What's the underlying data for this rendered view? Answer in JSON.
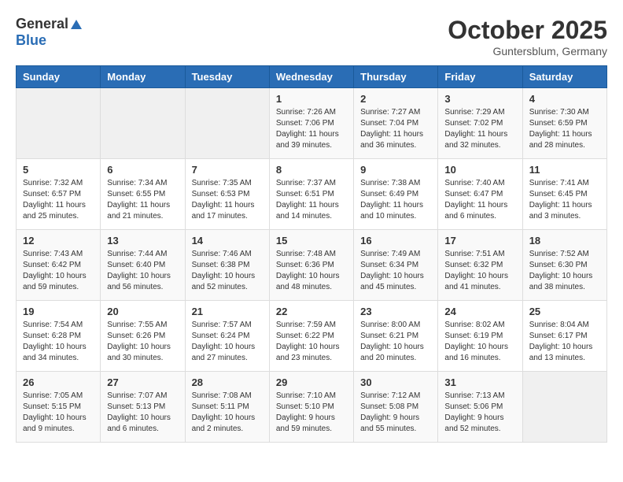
{
  "header": {
    "logo_general": "General",
    "logo_blue": "Blue",
    "month": "October 2025",
    "location": "Guntersblum, Germany"
  },
  "days_of_week": [
    "Sunday",
    "Monday",
    "Tuesday",
    "Wednesday",
    "Thursday",
    "Friday",
    "Saturday"
  ],
  "weeks": [
    [
      {
        "day": "",
        "sunrise": "",
        "sunset": "",
        "daylight": ""
      },
      {
        "day": "",
        "sunrise": "",
        "sunset": "",
        "daylight": ""
      },
      {
        "day": "",
        "sunrise": "",
        "sunset": "",
        "daylight": ""
      },
      {
        "day": "1",
        "sunrise": "Sunrise: 7:26 AM",
        "sunset": "Sunset: 7:06 PM",
        "daylight": "Daylight: 11 hours and 39 minutes."
      },
      {
        "day": "2",
        "sunrise": "Sunrise: 7:27 AM",
        "sunset": "Sunset: 7:04 PM",
        "daylight": "Daylight: 11 hours and 36 minutes."
      },
      {
        "day": "3",
        "sunrise": "Sunrise: 7:29 AM",
        "sunset": "Sunset: 7:02 PM",
        "daylight": "Daylight: 11 hours and 32 minutes."
      },
      {
        "day": "4",
        "sunrise": "Sunrise: 7:30 AM",
        "sunset": "Sunset: 6:59 PM",
        "daylight": "Daylight: 11 hours and 28 minutes."
      }
    ],
    [
      {
        "day": "5",
        "sunrise": "Sunrise: 7:32 AM",
        "sunset": "Sunset: 6:57 PM",
        "daylight": "Daylight: 11 hours and 25 minutes."
      },
      {
        "day": "6",
        "sunrise": "Sunrise: 7:34 AM",
        "sunset": "Sunset: 6:55 PM",
        "daylight": "Daylight: 11 hours and 21 minutes."
      },
      {
        "day": "7",
        "sunrise": "Sunrise: 7:35 AM",
        "sunset": "Sunset: 6:53 PM",
        "daylight": "Daylight: 11 hours and 17 minutes."
      },
      {
        "day": "8",
        "sunrise": "Sunrise: 7:37 AM",
        "sunset": "Sunset: 6:51 PM",
        "daylight": "Daylight: 11 hours and 14 minutes."
      },
      {
        "day": "9",
        "sunrise": "Sunrise: 7:38 AM",
        "sunset": "Sunset: 6:49 PM",
        "daylight": "Daylight: 11 hours and 10 minutes."
      },
      {
        "day": "10",
        "sunrise": "Sunrise: 7:40 AM",
        "sunset": "Sunset: 6:47 PM",
        "daylight": "Daylight: 11 hours and 6 minutes."
      },
      {
        "day": "11",
        "sunrise": "Sunrise: 7:41 AM",
        "sunset": "Sunset: 6:45 PM",
        "daylight": "Daylight: 11 hours and 3 minutes."
      }
    ],
    [
      {
        "day": "12",
        "sunrise": "Sunrise: 7:43 AM",
        "sunset": "Sunset: 6:42 PM",
        "daylight": "Daylight: 10 hours and 59 minutes."
      },
      {
        "day": "13",
        "sunrise": "Sunrise: 7:44 AM",
        "sunset": "Sunset: 6:40 PM",
        "daylight": "Daylight: 10 hours and 56 minutes."
      },
      {
        "day": "14",
        "sunrise": "Sunrise: 7:46 AM",
        "sunset": "Sunset: 6:38 PM",
        "daylight": "Daylight: 10 hours and 52 minutes."
      },
      {
        "day": "15",
        "sunrise": "Sunrise: 7:48 AM",
        "sunset": "Sunset: 6:36 PM",
        "daylight": "Daylight: 10 hours and 48 minutes."
      },
      {
        "day": "16",
        "sunrise": "Sunrise: 7:49 AM",
        "sunset": "Sunset: 6:34 PM",
        "daylight": "Daylight: 10 hours and 45 minutes."
      },
      {
        "day": "17",
        "sunrise": "Sunrise: 7:51 AM",
        "sunset": "Sunset: 6:32 PM",
        "daylight": "Daylight: 10 hours and 41 minutes."
      },
      {
        "day": "18",
        "sunrise": "Sunrise: 7:52 AM",
        "sunset": "Sunset: 6:30 PM",
        "daylight": "Daylight: 10 hours and 38 minutes."
      }
    ],
    [
      {
        "day": "19",
        "sunrise": "Sunrise: 7:54 AM",
        "sunset": "Sunset: 6:28 PM",
        "daylight": "Daylight: 10 hours and 34 minutes."
      },
      {
        "day": "20",
        "sunrise": "Sunrise: 7:55 AM",
        "sunset": "Sunset: 6:26 PM",
        "daylight": "Daylight: 10 hours and 30 minutes."
      },
      {
        "day": "21",
        "sunrise": "Sunrise: 7:57 AM",
        "sunset": "Sunset: 6:24 PM",
        "daylight": "Daylight: 10 hours and 27 minutes."
      },
      {
        "day": "22",
        "sunrise": "Sunrise: 7:59 AM",
        "sunset": "Sunset: 6:22 PM",
        "daylight": "Daylight: 10 hours and 23 minutes."
      },
      {
        "day": "23",
        "sunrise": "Sunrise: 8:00 AM",
        "sunset": "Sunset: 6:21 PM",
        "daylight": "Daylight: 10 hours and 20 minutes."
      },
      {
        "day": "24",
        "sunrise": "Sunrise: 8:02 AM",
        "sunset": "Sunset: 6:19 PM",
        "daylight": "Daylight: 10 hours and 16 minutes."
      },
      {
        "day": "25",
        "sunrise": "Sunrise: 8:04 AM",
        "sunset": "Sunset: 6:17 PM",
        "daylight": "Daylight: 10 hours and 13 minutes."
      }
    ],
    [
      {
        "day": "26",
        "sunrise": "Sunrise: 7:05 AM",
        "sunset": "Sunset: 5:15 PM",
        "daylight": "Daylight: 10 hours and 9 minutes."
      },
      {
        "day": "27",
        "sunrise": "Sunrise: 7:07 AM",
        "sunset": "Sunset: 5:13 PM",
        "daylight": "Daylight: 10 hours and 6 minutes."
      },
      {
        "day": "28",
        "sunrise": "Sunrise: 7:08 AM",
        "sunset": "Sunset: 5:11 PM",
        "daylight": "Daylight: 10 hours and 2 minutes."
      },
      {
        "day": "29",
        "sunrise": "Sunrise: 7:10 AM",
        "sunset": "Sunset: 5:10 PM",
        "daylight": "Daylight: 9 hours and 59 minutes."
      },
      {
        "day": "30",
        "sunrise": "Sunrise: 7:12 AM",
        "sunset": "Sunset: 5:08 PM",
        "daylight": "Daylight: 9 hours and 55 minutes."
      },
      {
        "day": "31",
        "sunrise": "Sunrise: 7:13 AM",
        "sunset": "Sunset: 5:06 PM",
        "daylight": "Daylight: 9 hours and 52 minutes."
      },
      {
        "day": "",
        "sunrise": "",
        "sunset": "",
        "daylight": ""
      }
    ]
  ]
}
